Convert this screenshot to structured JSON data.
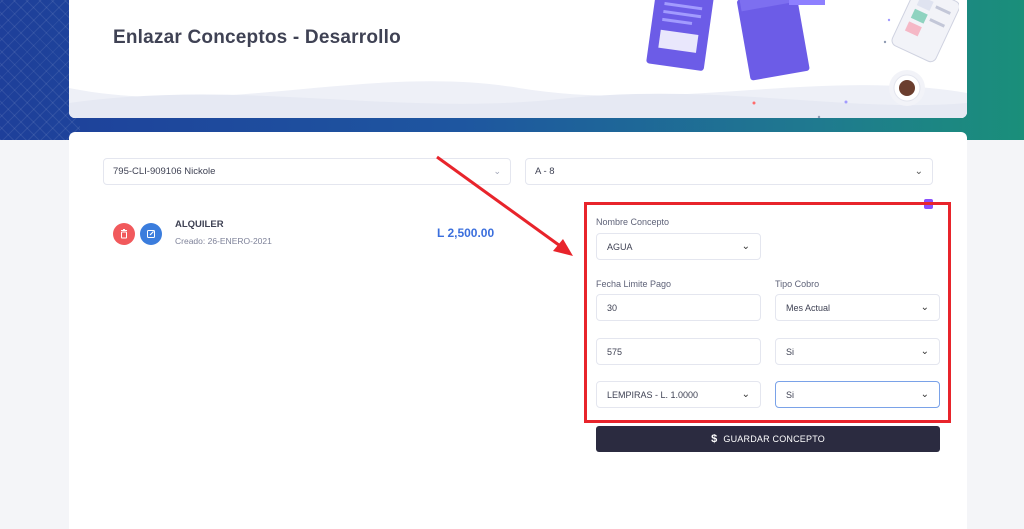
{
  "header": {
    "title": "Enlazar Conceptos - Desarrollo"
  },
  "filters": {
    "client_select": "795-CLI-909106 Nickole",
    "unit_select": "A - 8"
  },
  "concept_item": {
    "name": "ALQUILER",
    "created": "Creado: 26-ENERO-2021",
    "amount": "L 2,500.00"
  },
  "form": {
    "nombre_label": "Nombre Concepto",
    "nombre_value": "AGUA",
    "fecha_label": "Fecha Limite Pago",
    "fecha_value": "30",
    "tipo_label": "Tipo Cobro",
    "tipo_value": "Mes Actual",
    "monto_value": "575",
    "si_value_1": "Si",
    "moneda_value": "LEMPIRAS - L. 1.0000",
    "si_value_2": "Si",
    "save_label": "GUARDAR CONCEPTO"
  },
  "colors": {
    "annotation_red": "#e8242b",
    "primary_blue": "#3b6fdd",
    "dark_button": "#2b2b40"
  },
  "icons": {
    "delete": "trash-icon",
    "edit": "edit-icon",
    "save": "dollar-icon",
    "info": "info-icon"
  }
}
